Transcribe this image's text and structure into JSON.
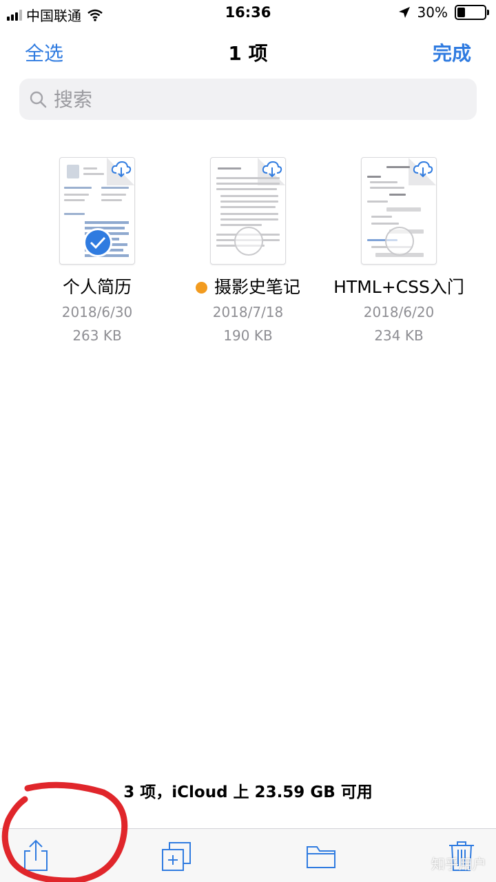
{
  "status_bar": {
    "carrier": "中国联通",
    "time": "16:36",
    "battery": "30%",
    "battery_level": 0.3
  },
  "nav": {
    "select_all": "全选",
    "title": "1 项",
    "done": "完成"
  },
  "search": {
    "placeholder": "搜索"
  },
  "files": [
    {
      "name": "个人简历",
      "date": "2018/6/30",
      "size": "263 KB",
      "selected": true,
      "icon": "cloud-download-icon"
    },
    {
      "name": "摄影史笔记",
      "date": "2018/7/18",
      "size": "190 KB",
      "tag_color": "#f29b1f",
      "icon": "cloud-download-icon"
    },
    {
      "name": "HTML+CSS入门",
      "date": "2018/6/20",
      "size": "234 KB",
      "icon": "cloud-download-icon"
    }
  ],
  "summary": "3 项，iCloud 上 23.59 GB 可用",
  "toolbar": {
    "icons": [
      "share-icon",
      "duplicate-icon",
      "move-folder-icon",
      "trash-icon"
    ]
  },
  "watermark": "知乎用户",
  "colors": {
    "accent": "#2f7be0",
    "tag_orange": "#f29b1f",
    "annotation_red": "#e0262b"
  }
}
